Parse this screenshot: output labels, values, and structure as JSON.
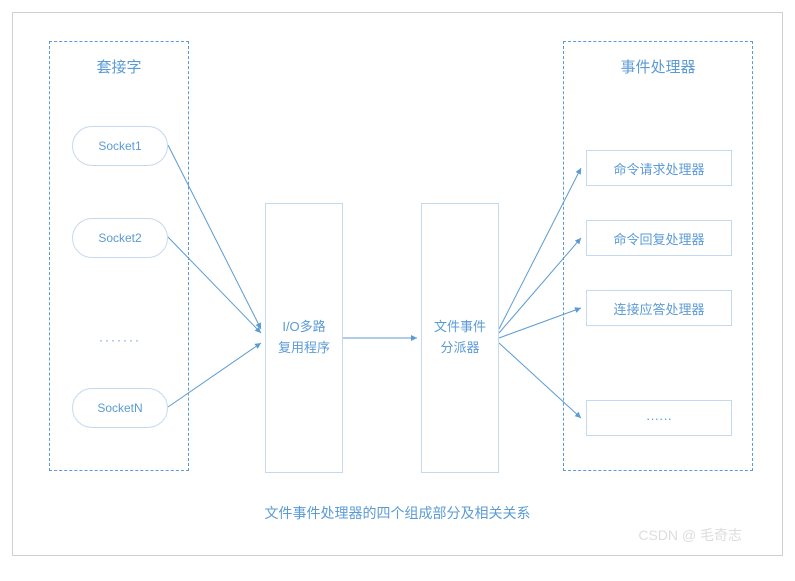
{
  "sockets": {
    "title": "套接字",
    "items": [
      "Socket1",
      "Socket2",
      "·······",
      "SocketN"
    ]
  },
  "mux": {
    "line1": "I/O多路",
    "line2": "复用程序"
  },
  "dispatcher": {
    "line1": "文件事件",
    "line2": "分派器"
  },
  "handlers": {
    "title": "事件处理器",
    "items": [
      "命令请求处理器",
      "命令回复处理器",
      "连接应答处理器",
      "······"
    ]
  },
  "caption": "文件事件处理器的四个组成部分及相关关系",
  "watermark": "CSDN @ 毛奇志"
}
